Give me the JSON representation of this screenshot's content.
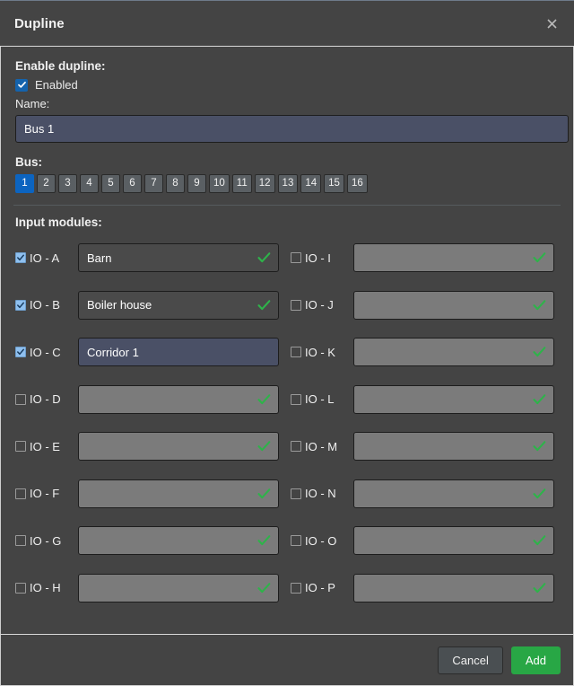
{
  "dialog": {
    "title": "Dupline",
    "close_icon": "close-icon"
  },
  "enable_section": {
    "label": "Enable dupline:",
    "checkbox_label": "Enabled",
    "checked": true
  },
  "name_section": {
    "label": "Name:",
    "value": "Bus 1",
    "placeholder": ""
  },
  "bus_section": {
    "label": "Bus:",
    "buttons": [
      "1",
      "2",
      "3",
      "4",
      "5",
      "6",
      "7",
      "8",
      "9",
      "10",
      "11",
      "12",
      "13",
      "14",
      "15",
      "16"
    ],
    "selected": "1"
  },
  "input_modules": {
    "label": "Input modules:",
    "rows": [
      {
        "label": "IO - A",
        "checked": true,
        "value": "Barn",
        "state": "enabled",
        "tick": true
      },
      {
        "label": "IO - I",
        "checked": false,
        "value": "",
        "state": "disabled",
        "tick": true
      },
      {
        "label": "IO - B",
        "checked": true,
        "value": "Boiler house",
        "state": "enabled",
        "tick": true
      },
      {
        "label": "IO - J",
        "checked": false,
        "value": "",
        "state": "disabled",
        "tick": true
      },
      {
        "label": "IO - C",
        "checked": true,
        "value": "Corridor 1",
        "state": "focused",
        "tick": false
      },
      {
        "label": "IO - K",
        "checked": false,
        "value": "",
        "state": "disabled",
        "tick": true
      },
      {
        "label": "IO - D",
        "checked": false,
        "value": "",
        "state": "disabled",
        "tick": true
      },
      {
        "label": "IO - L",
        "checked": false,
        "value": "",
        "state": "disabled",
        "tick": true
      },
      {
        "label": "IO - E",
        "checked": false,
        "value": "",
        "state": "disabled",
        "tick": true
      },
      {
        "label": "IO - M",
        "checked": false,
        "value": "",
        "state": "disabled",
        "tick": true
      },
      {
        "label": "IO - F",
        "checked": false,
        "value": "",
        "state": "disabled",
        "tick": true
      },
      {
        "label": "IO - N",
        "checked": false,
        "value": "",
        "state": "disabled",
        "tick": true
      },
      {
        "label": "IO - G",
        "checked": false,
        "value": "",
        "state": "disabled",
        "tick": true
      },
      {
        "label": "IO - O",
        "checked": false,
        "value": "",
        "state": "disabled",
        "tick": true
      },
      {
        "label": "IO - H",
        "checked": false,
        "value": "",
        "state": "disabled",
        "tick": true
      },
      {
        "label": "IO - P",
        "checked": false,
        "value": "",
        "state": "disabled",
        "tick": true
      }
    ]
  },
  "footer": {
    "cancel_label": "Cancel",
    "add_label": "Add"
  },
  "colors": {
    "accent_blue": "#0c64c0",
    "add_green": "#28a745",
    "tick_green": "#2eb34a",
    "dialog_bg": "#444444",
    "field_bg": "#4a4a4a",
    "field_disabled_bg": "#7b7b7b",
    "field_focus_bg": "#4a5066"
  }
}
